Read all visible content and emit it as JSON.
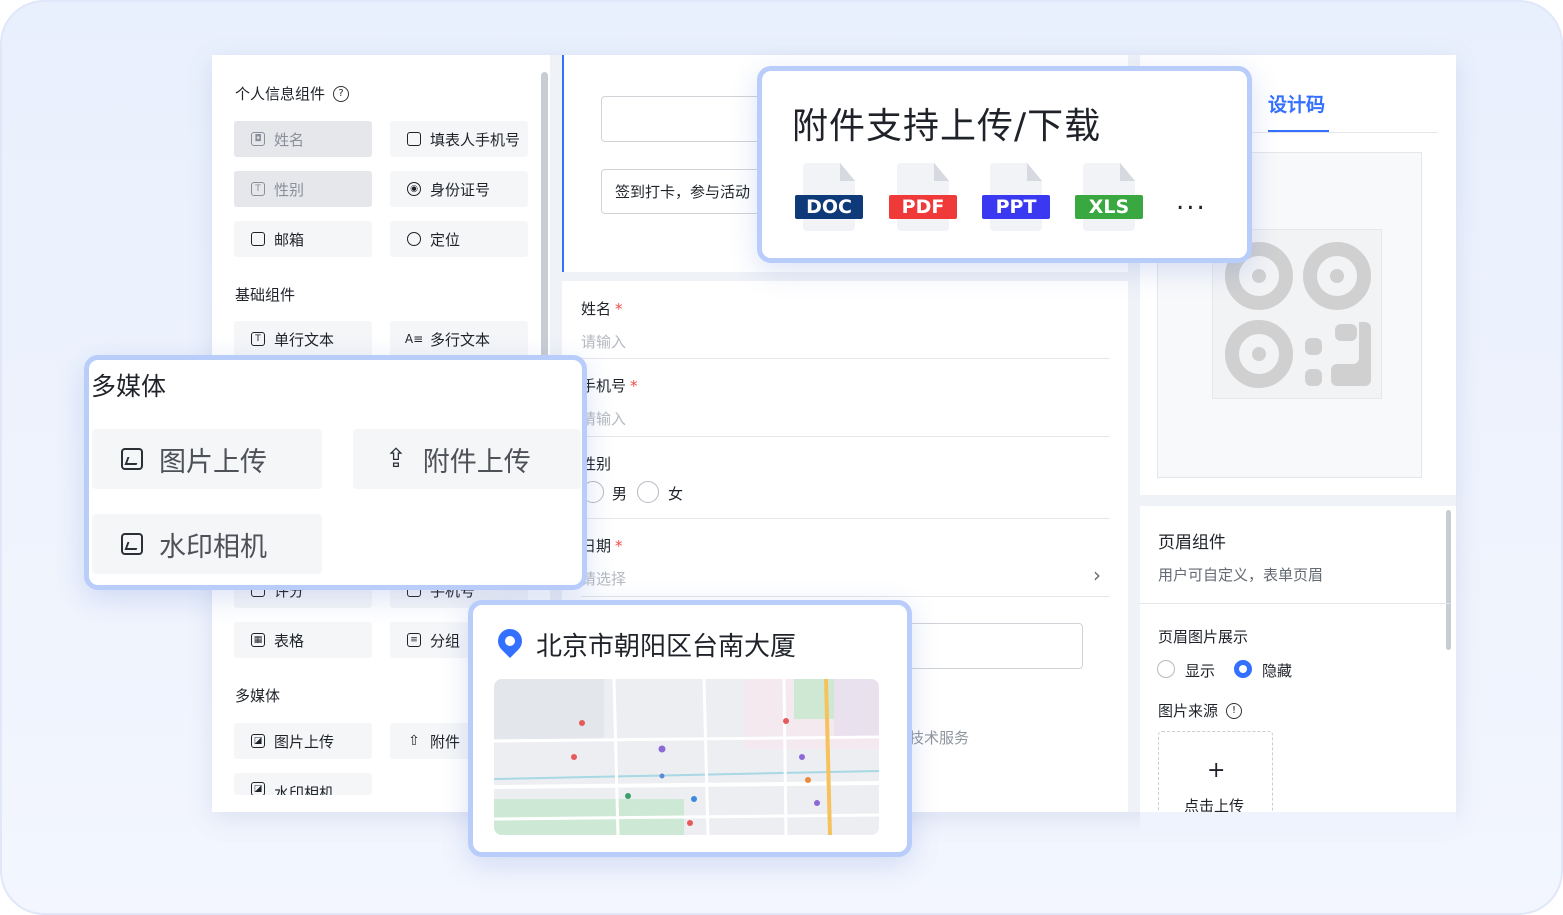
{
  "colors": {
    "accent": "#3370ff",
    "required": "#f54a45",
    "doc": "#0e3a79",
    "pdf": "#f03a3a",
    "ppt": "#3a38f0",
    "xls": "#3aa841"
  },
  "left_panel": {
    "personal_title": "个人信息组件",
    "personal_items": [
      {
        "label": "姓名",
        "icon": "user-card-icon"
      },
      {
        "label": "填表人手机号",
        "icon": "phone-icon"
      },
      {
        "label": "性别",
        "icon": "text-t-icon"
      },
      {
        "label": "身份证号",
        "icon": "id-card-icon"
      },
      {
        "label": "邮箱",
        "icon": "mail-icon"
      },
      {
        "label": "定位",
        "icon": "location-icon"
      }
    ],
    "basic_title": "基础组件",
    "basic_items": [
      {
        "label": "单行文本",
        "icon": "text-t-icon"
      },
      {
        "label": "多行文本",
        "icon": "multiline-text-icon"
      },
      {
        "label": "评分",
        "icon": "star-icon"
      },
      {
        "label": "手机号",
        "icon": "phone-icon"
      },
      {
        "label": "表格",
        "icon": "table-icon"
      },
      {
        "label": "分组",
        "icon": "group-icon"
      }
    ],
    "media_title": "多媒体",
    "media_items": [
      {
        "label": "图片上传",
        "icon": "image-icon"
      },
      {
        "label": "附件",
        "icon": "upload-icon"
      },
      {
        "label": "水印相机",
        "icon": "camera-icon"
      }
    ]
  },
  "canvas": {
    "description_text": "签到打卡，参与活动",
    "fields": [
      {
        "label": "姓名",
        "required": true,
        "placeholder": "请输入"
      },
      {
        "label": "手机号",
        "required": true,
        "placeholder": "请输入"
      },
      {
        "label": "性别",
        "required": false,
        "options": [
          "男",
          "女"
        ]
      },
      {
        "label": "日期",
        "required": true,
        "placeholder": "请选择"
      }
    ],
    "footer_text": "技术服务"
  },
  "right_panel": {
    "active_tab": "设计码",
    "header_title": "页眉组件",
    "header_desc": "用户可自定义，表单页眉",
    "image_display_label": "页眉图片展示",
    "display_options": [
      "显示",
      "隐藏"
    ],
    "display_selected": "隐藏",
    "image_source_label": "图片来源",
    "upload_plus": "+",
    "upload_label": "点击上传"
  },
  "attachment_card": {
    "title": "附件支持上传/下载",
    "file_types": [
      "DOC",
      "PDF",
      "PPT",
      "XLS"
    ],
    "more": "..."
  },
  "media_card": {
    "title": "多媒体",
    "items": [
      "图片上传",
      "附件上传",
      "水印相机"
    ]
  },
  "location_card": {
    "title": "北京市朝阳区台南大厦"
  }
}
